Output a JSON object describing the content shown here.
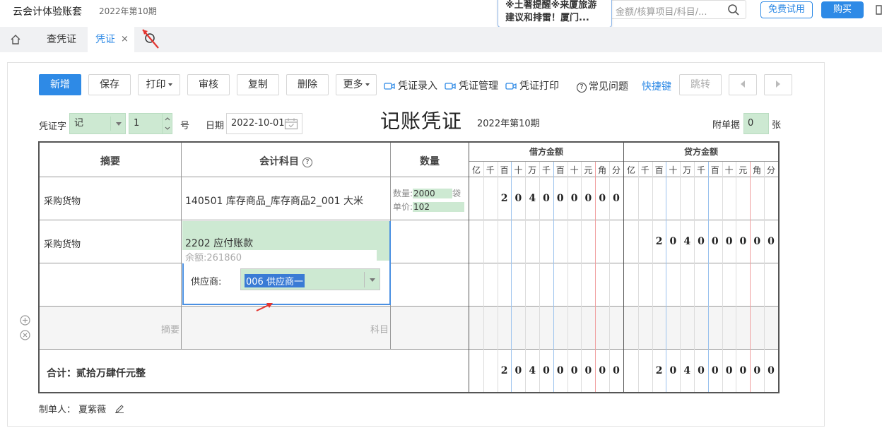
{
  "header": {
    "app_title": "云会计体验账套",
    "period": "2022年第10期",
    "search_placeholder": "金额/核算项目/科目/...",
    "tip_line1": "※土著提醒※来厦旅游",
    "tip_line2": "建议和排雷！厦门...",
    "trial_button": "免费试用",
    "buy_button": "购买"
  },
  "tabs": {
    "query_voucher": "查凭证",
    "voucher": "凭证",
    "close": "×"
  },
  "toolbar": {
    "new": "新增",
    "save": "保存",
    "print": "打印",
    "audit": "审核",
    "copy": "复制",
    "delete": "删除",
    "more": "更多",
    "voucher_entry": "凭证录入",
    "voucher_manage": "凭证管理",
    "voucher_print": "凭证打印",
    "faq": "常见问题",
    "shortcuts": "快捷键",
    "jump": "跳转"
  },
  "voucher_header": {
    "word_label": "凭证字",
    "word_value": "记",
    "number_value": "1",
    "number_suffix": "号",
    "date_label": "日期",
    "date_value": "2022-10-01",
    "title": "记账凭证",
    "period": "2022年第10期",
    "attach_label": "附单据",
    "attach_value": "0",
    "attach_unit": "张"
  },
  "grid": {
    "col_summary": "摘要",
    "col_account": "会计科目",
    "col_qty": "数量",
    "col_debit": "借方金额",
    "col_credit": "贷方金额",
    "digit_headers": [
      "亿",
      "千",
      "百",
      "十",
      "万",
      "千",
      "百",
      "十",
      "元",
      "角",
      "分"
    ],
    "rows": [
      {
        "summary": "采购货物",
        "account": "140501 库存商品_库存商品2_001 大米",
        "qty_label": "数量:",
        "qty_value": "2000",
        "qty_unit": "袋",
        "price_label": "单价:",
        "price_value": "102",
        "debit": "204000000",
        "credit": ""
      },
      {
        "summary": "采购货物",
        "account": "2202 应付账款",
        "balance": "余额:261860",
        "supplier_label": "供应商:",
        "supplier_value": "006 供应商一",
        "debit": "",
        "credit": "204000000"
      }
    ],
    "placeholder_summary": "摘要",
    "placeholder_account": "科目",
    "total_label": "合计：贰拾万肆仟元整",
    "total_debit": "204000000",
    "total_credit": "204000000"
  },
  "footer": {
    "maker_label": "制单人：",
    "maker_name": "夏紫薇"
  },
  "colors": {
    "accent": "#2e8ae6",
    "field_green": "#cde9d2",
    "grid_border": "#555555"
  }
}
